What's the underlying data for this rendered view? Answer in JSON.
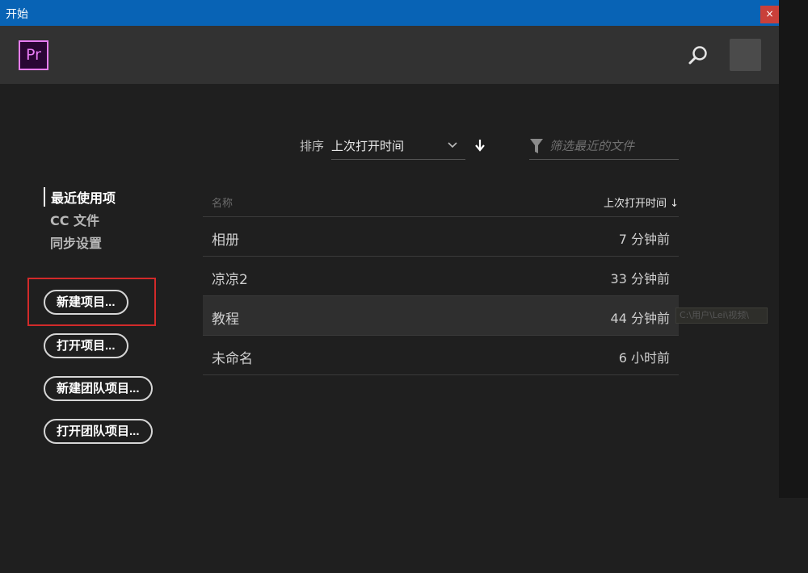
{
  "window": {
    "title": "开始",
    "close_glyph": "×"
  },
  "header": {
    "logo_text": "Pr",
    "logo_color": "#e77cf4",
    "search_icon": "search-icon",
    "avatar": "avatar"
  },
  "sort": {
    "label": "排序",
    "value": "上次打开时间"
  },
  "filter": {
    "placeholder": "筛选最近的文件"
  },
  "nav": {
    "items": [
      {
        "label": "最近使用项",
        "active": true
      },
      {
        "label": "CC 文件",
        "active": false
      },
      {
        "label": "同步设置",
        "active": false
      }
    ]
  },
  "buttons": {
    "new_project": "新建项目...",
    "open_project": "打开项目...",
    "new_team_project": "新建团队项目...",
    "open_team_project": "打开团队项目..."
  },
  "table": {
    "columns": {
      "name": "名称",
      "time": "上次打开时间 ↓"
    },
    "rows": [
      {
        "name": "相册",
        "time": "7 分钟前"
      },
      {
        "name": "凉凉2",
        "time": "33 分钟前"
      },
      {
        "name": "教程",
        "time": "44 分钟前"
      },
      {
        "name": "未命名",
        "time": "6 小时前"
      }
    ]
  },
  "tooltip": {
    "text": "C:\\用户\\Lei\\视频\\"
  },
  "colors": {
    "titlebar": "#0863b5",
    "close": "#c9403a",
    "highlight": "#d22a2a",
    "background": "#1f1f1f"
  }
}
